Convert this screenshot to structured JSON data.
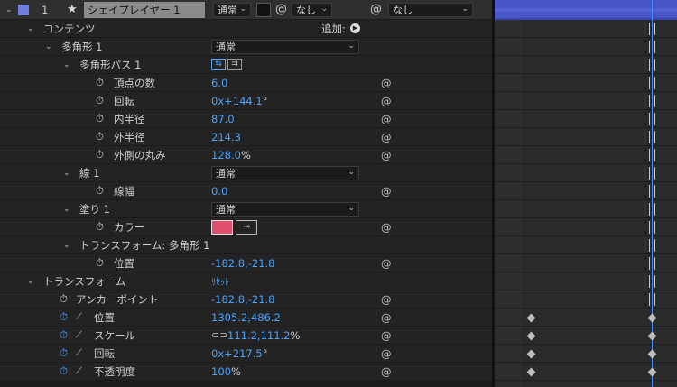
{
  "layer": {
    "number": "1",
    "name": "シェイプレイヤー 1",
    "mode": "通常",
    "trkmat": "なし",
    "parent": "なし",
    "label_color": "#6f7fe0"
  },
  "contents": {
    "label": "コンテンツ",
    "add_label": "追加:"
  },
  "polygon": {
    "label": "多角形 1",
    "mode": "通常"
  },
  "polypath": {
    "label": "多角形パス 1",
    "props": [
      {
        "label": "頂点の数",
        "value": "6.0",
        "unit": ""
      },
      {
        "label": "回転",
        "value": "0x+144.1",
        "unit": "°"
      },
      {
        "label": "内半径",
        "value": "87.0",
        "unit": ""
      },
      {
        "label": "外半径",
        "value": "214.3",
        "unit": ""
      },
      {
        "label": "外側の丸み",
        "value": "128.0",
        "unit": "%"
      }
    ]
  },
  "stroke": {
    "label": "線 1",
    "mode": "通常",
    "width_label": "線幅",
    "width_value": "0.0"
  },
  "fill": {
    "label": "塗り 1",
    "mode": "通常",
    "color_label": "カラー",
    "color": "#e0506e"
  },
  "polytransform": {
    "label": "トランスフォーム: 多角形 1",
    "pos_label": "位置",
    "pos_value": "-182.8,-21.8"
  },
  "transform": {
    "label": "トランスフォーム",
    "reset": "ﾘｾｯﾄ",
    "props": [
      {
        "label": "アンカーポイント",
        "value": "-182.8,-21.8",
        "unit": ""
      },
      {
        "label": "位置",
        "value": "1305.2,486.2",
        "unit": ""
      },
      {
        "label": "スケール",
        "value": "111.2,111.2",
        "unit": "%"
      },
      {
        "label": "回転",
        "value": "0x+217.5",
        "unit": "°"
      },
      {
        "label": "不透明度",
        "value": "100",
        "unit": "%"
      }
    ]
  },
  "colors": {
    "value_blue": "#4aa3ff",
    "layer_bar": "#4a56c8",
    "playhead": "#3c8cff"
  }
}
